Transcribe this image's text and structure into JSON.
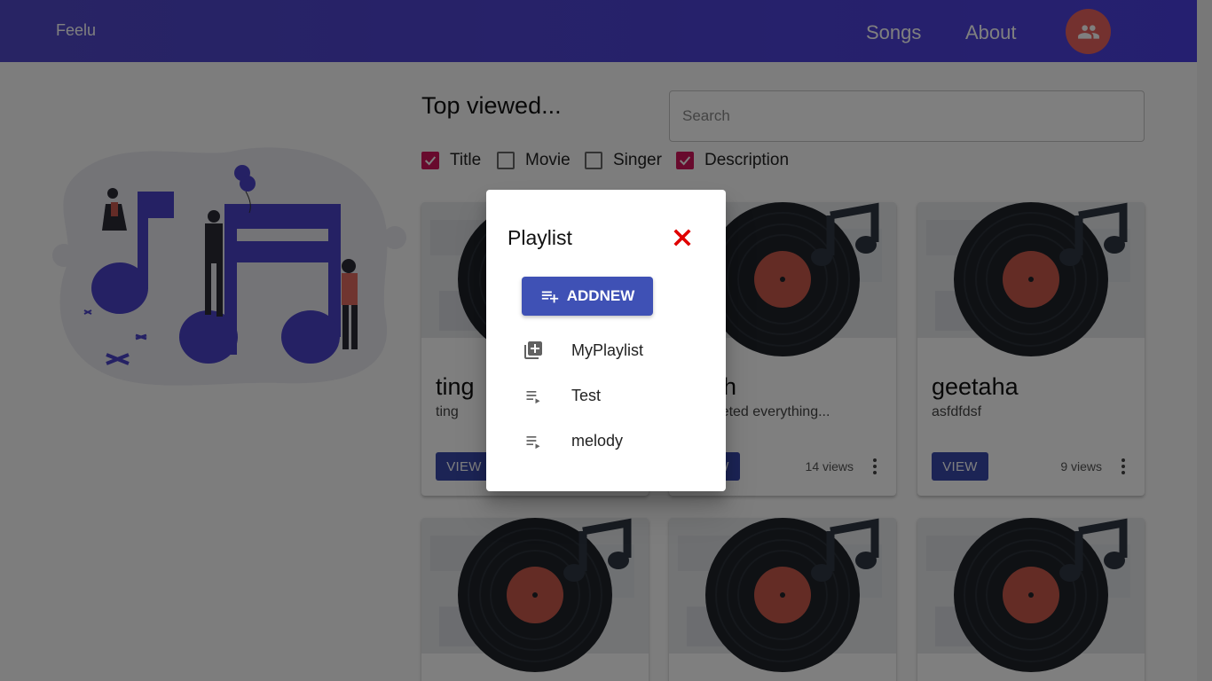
{
  "appbar": {
    "brand": "Feelu",
    "nav": [
      "Songs",
      "About"
    ],
    "avatar_icon": "people-icon"
  },
  "main": {
    "heading": "Top viewed...",
    "search": {
      "placeholder": "Search",
      "value": ""
    },
    "filters": [
      {
        "label": "Title",
        "checked": true
      },
      {
        "label": "Movie",
        "checked": false
      },
      {
        "label": "Singer",
        "checked": false
      },
      {
        "label": "Description",
        "checked": true
      }
    ],
    "cards": [
      {
        "title": "ting",
        "desc": "ting",
        "views": "",
        "button": "VIEW"
      },
      {
        "title": "Allah",
        "desc": "completed everything...",
        "views": "14 views",
        "button": "VIEW"
      },
      {
        "title": "geetaha",
        "desc": "asfdfdsf",
        "views": "9 views",
        "button": "VIEW"
      },
      {
        "title": "",
        "desc": "",
        "views": "",
        "button": ""
      },
      {
        "title": "",
        "desc": "",
        "views": "",
        "button": ""
      },
      {
        "title": "",
        "desc": "",
        "views": "",
        "button": ""
      }
    ]
  },
  "dialog": {
    "title": "Playlist",
    "add_button": "ADDNEW",
    "items": [
      {
        "label": "MyPlaylist",
        "icon": "library-add-icon"
      },
      {
        "label": "Test",
        "icon": "playlist-play-icon"
      },
      {
        "label": "melody",
        "icon": "playlist-play-icon"
      }
    ]
  },
  "colors": {
    "appbar": "#4b3fe0",
    "accent": "#3f51b5",
    "checkbox": "#d1145a",
    "close": "#e00000",
    "avatar": "#e8625f"
  }
}
